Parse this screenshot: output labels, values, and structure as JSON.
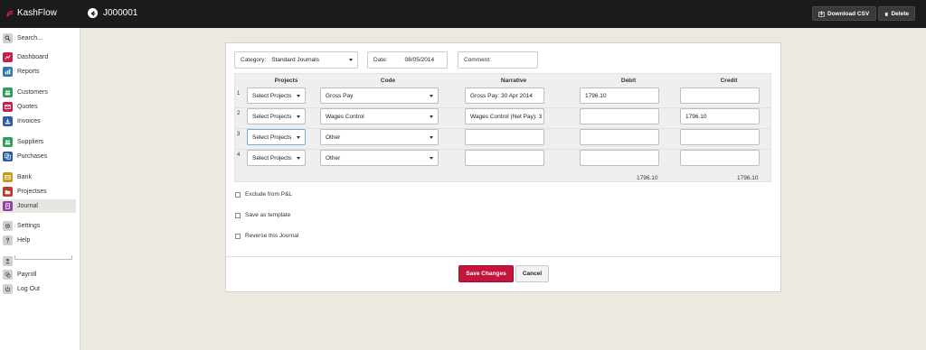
{
  "app": {
    "brand": "KashFlow",
    "page_title": "J000001",
    "download_csv_label": "Download CSV",
    "delete_label": "Delete"
  },
  "sidebar": {
    "search_placeholder": "Search...",
    "items": [
      {
        "label": "Dashboard",
        "icon": "dashboard-icon",
        "color": "#c61d4a"
      },
      {
        "label": "Reports",
        "icon": "reports-icon",
        "color": "#2d78b7"
      },
      {
        "label": "Customers",
        "icon": "customers-icon",
        "color": "#2f9e5b"
      },
      {
        "label": "Quotes",
        "icon": "quotes-icon",
        "color": "#c61d4a"
      },
      {
        "label": "Invoices",
        "icon": "invoices-icon",
        "color": "#2d5fa8"
      },
      {
        "label": "Suppliers",
        "icon": "suppliers-icon",
        "color": "#2f9e5b"
      },
      {
        "label": "Purchases",
        "icon": "purchases-icon",
        "color": "#2d5fa8"
      },
      {
        "label": "Bank",
        "icon": "bank-icon",
        "color": "#c59b1e"
      },
      {
        "label": "Projectses",
        "icon": "projects-icon",
        "color": "#c0392b"
      },
      {
        "label": "Journal",
        "icon": "journal-icon",
        "color": "#8e3fa8"
      },
      {
        "label": "Settings",
        "icon": "gear-icon",
        "color": "#888888"
      },
      {
        "label": "Help",
        "icon": "help-icon",
        "color": "#888888"
      },
      {
        "label": "",
        "icon": "user-icon",
        "color": "#888888"
      },
      {
        "label": "Payroll",
        "icon": "payroll-icon",
        "color": "#888888"
      },
      {
        "label": "Log Out",
        "icon": "logout-icon",
        "color": "#888888"
      }
    ]
  },
  "form": {
    "category_label": "Category:",
    "category_value": "Standard Journals",
    "date_label": "Date:",
    "date_value": "08/05/2014",
    "comment_label": "Comment:",
    "comment_value": ""
  },
  "grid": {
    "headers": {
      "projects": "Projects",
      "code": "Code",
      "narrative": "Narrative",
      "debit": "Debit",
      "credit": "Credit"
    },
    "rows": [
      {
        "num": "1",
        "project": "Select Projects",
        "code": "Gross Pay",
        "narrative": "Gross Pay: 30 Apr 2014",
        "debit": "1796.10",
        "credit": ""
      },
      {
        "num": "2",
        "project": "Select Projects",
        "code": "Wages Control",
        "narrative": "Wages Control (Net Pay): 3",
        "debit": "",
        "credit": "1796.10"
      },
      {
        "num": "3",
        "project": "Select Projects",
        "code": "Other",
        "narrative": "",
        "debit": "",
        "credit": ""
      },
      {
        "num": "4",
        "project": "Select Projects",
        "code": "Other",
        "narrative": "",
        "debit": "",
        "credit": ""
      }
    ],
    "total_debit": "1796.10",
    "total_credit": "1796.10"
  },
  "options": {
    "exclude_label": "Exclude from P&L",
    "template_label": "Save as template",
    "reverse_label": "Reverse this Journal"
  },
  "actions": {
    "save_label": "Save Changes",
    "cancel_label": "Cancel"
  }
}
